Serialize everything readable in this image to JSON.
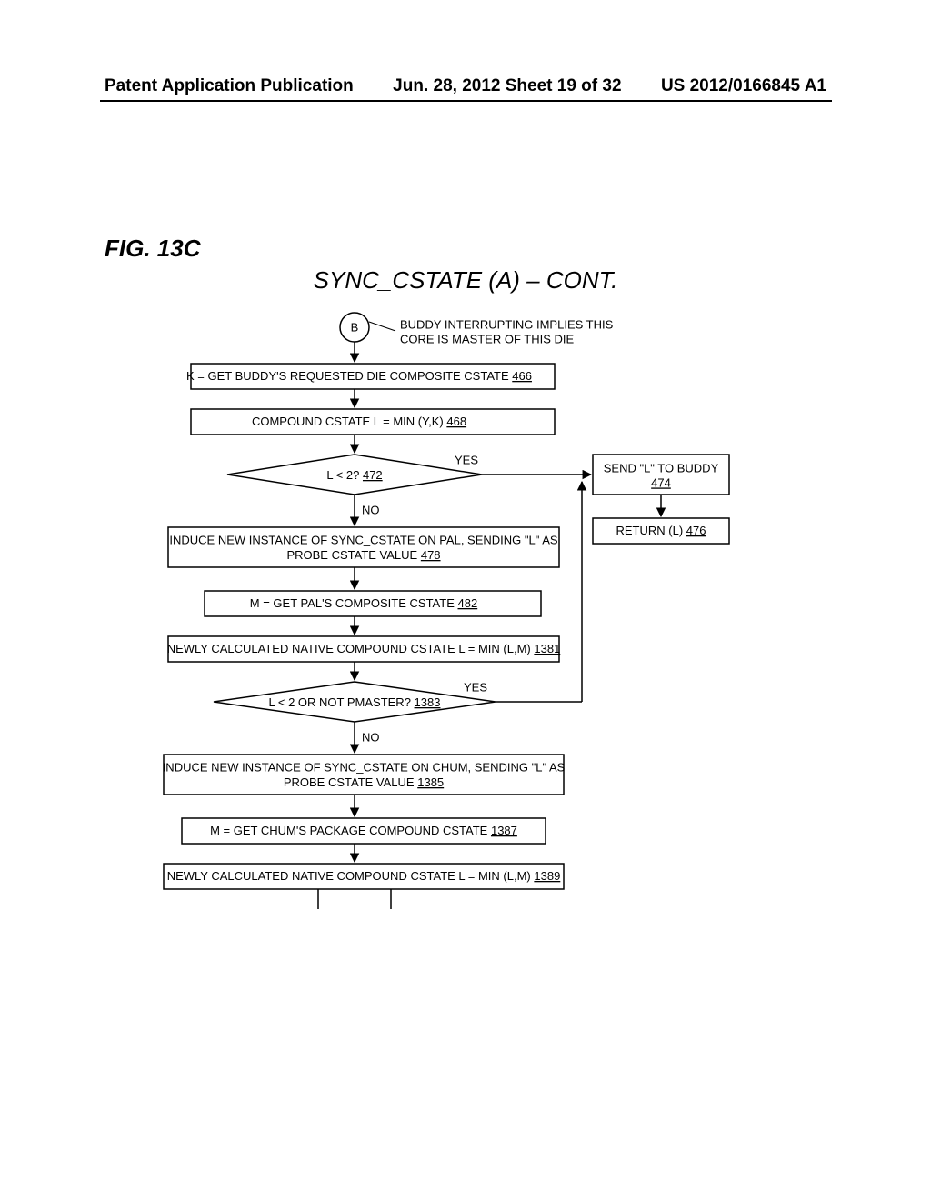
{
  "header": {
    "left": "Patent Application Publication",
    "center": "Jun. 28, 2012  Sheet 19 of 32",
    "right": "US 2012/0166845 A1"
  },
  "figure_label": "FIG. 13C",
  "title": "SYNC_CSTATE (A) – CONT.",
  "connector": {
    "label": "B",
    "note1": "BUDDY INTERRUPTING IMPLIES THIS",
    "note2": "CORE IS MASTER OF THIS DIE"
  },
  "boxes": {
    "b466": {
      "text": "K = GET BUDDY'S REQUESTED DIE COMPOSITE CSTATE",
      "ref": "466"
    },
    "b468": {
      "text": "COMPOUND CSTATE L = MIN (Y,K)",
      "ref": "468"
    },
    "d472": {
      "text": "L < 2?",
      "ref": "472"
    },
    "b474": {
      "text": "SEND \"L\" TO BUDDY",
      "ref": "474"
    },
    "b476": {
      "text": "RETURN (L)",
      "ref": "476"
    },
    "b478": {
      "text1": "INDUCE NEW INSTANCE OF SYNC_CSTATE ON PAL, SENDING \"L\" AS",
      "text2": "PROBE CSTATE VALUE",
      "ref": "478"
    },
    "b482": {
      "text": "M = GET PAL'S COMPOSITE CSTATE",
      "ref": "482"
    },
    "b1381": {
      "text": "NEWLY CALCULATED NATIVE COMPOUND CSTATE L =  MIN (L,M)",
      "ref": "1381"
    },
    "d1383": {
      "text": "L < 2 OR NOT PMASTER?",
      "ref": "1383"
    },
    "b1385": {
      "text1": "INDUCE NEW INSTANCE OF SYNC_CSTATE ON CHUM, SENDING \"L\" AS",
      "text2": "PROBE CSTATE VALUE",
      "ref": "1385"
    },
    "b1387": {
      "text": "M = GET CHUM'S PACKAGE COMPOUND CSTATE",
      "ref": "1387"
    },
    "b1389": {
      "text": "NEWLY CALCULATED NATIVE COMPOUND CSTATE L =  MIN (L,M)",
      "ref": "1389"
    }
  },
  "labels": {
    "yes": "YES",
    "no": "NO"
  }
}
